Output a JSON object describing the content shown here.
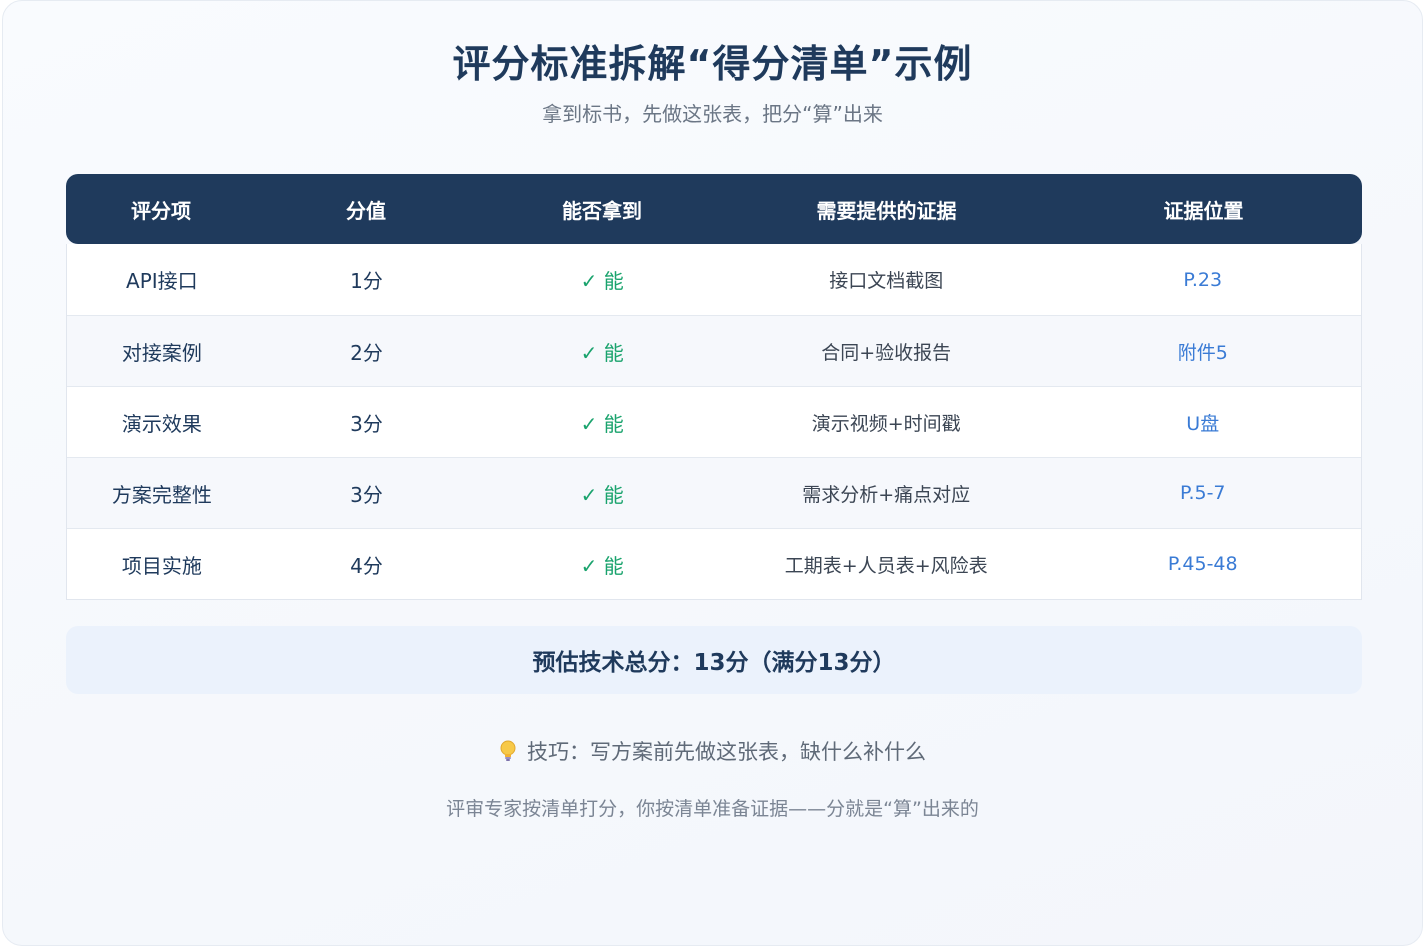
{
  "title": "评分标准拆解“得分清单”示例",
  "subtitle": "拿到标书，先做这张表，把分“算”出来",
  "table": {
    "headers": [
      "评分项",
      "分值",
      "能否拿到",
      "需要提供的证据",
      "证据位置"
    ],
    "rows": [
      {
        "item": "API接口",
        "score": "1分",
        "can": "✓ 能",
        "evidence": "接口文档截图",
        "location": "P.23"
      },
      {
        "item": "对接案例",
        "score": "2分",
        "can": "✓ 能",
        "evidence": "合同+验收报告",
        "location": "附件5"
      },
      {
        "item": "演示效果",
        "score": "3分",
        "can": "✓ 能",
        "evidence": "演示视频+时间戳",
        "location": "U盘"
      },
      {
        "item": "方案完整性",
        "score": "3分",
        "can": "✓ 能",
        "evidence": "需求分析+痛点对应",
        "location": "P.5-7"
      },
      {
        "item": "项目实施",
        "score": "4分",
        "can": "✓ 能",
        "evidence": "工期表+人员表+风险表",
        "location": "P.45-48"
      }
    ]
  },
  "total": "预估技术总分：13分（满分13分）",
  "tip": {
    "icon": "lightbulb-icon",
    "text": "技巧：写方案前先做这张表，缺什么补什么"
  },
  "note": "评审专家按清单打分，你按清单准备证据——分就是“算”出来的",
  "colors": {
    "header_bg": "#1f3a5c",
    "check": "#1aa36d",
    "link": "#3a7bd5",
    "total_bg": "#ebf2fc"
  }
}
